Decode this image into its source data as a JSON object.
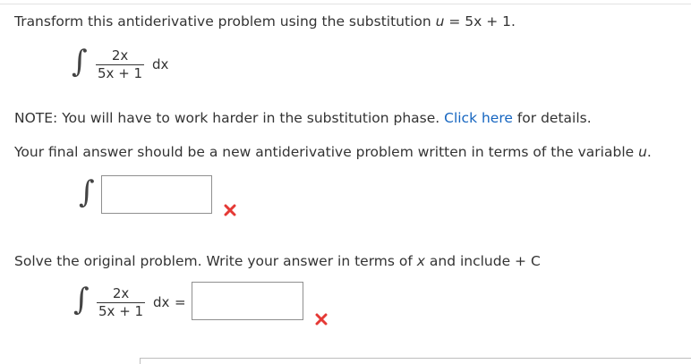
{
  "problem": {
    "intro": "Transform this antiderivative problem using the substitution ",
    "sub_var": "u",
    "sub_rest": " = 5x + 1.",
    "numerator": "2x",
    "denominator": "5x + 1",
    "dx": "dx"
  },
  "note": {
    "before": "NOTE: You will have to work harder in the substitution phase. ",
    "link": "Click here",
    "after": " for details."
  },
  "instruction": {
    "text": "Your final answer should be a new antiderivative problem written in terms of the variable ",
    "var": "u",
    "end": "."
  },
  "transform_answer": {
    "value": "",
    "status": "incorrect"
  },
  "solve": {
    "before": "Solve the original problem. Write your answer in terms of ",
    "var": "x",
    "after": " and include + C",
    "numerator": "2x",
    "denominator": "5x + 1",
    "dx": "dx",
    "equals": "="
  },
  "solve_answer": {
    "value": "",
    "status": "incorrect"
  },
  "integral_symbol": "∫",
  "colors": {
    "link": "#1565c0",
    "error": "#e53935",
    "text": "#333333"
  }
}
